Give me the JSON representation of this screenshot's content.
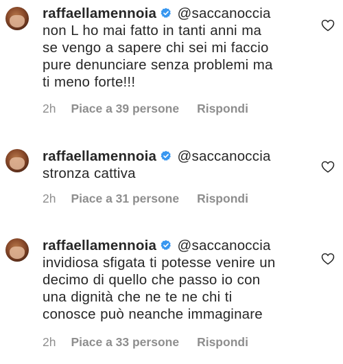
{
  "comments": [
    {
      "username": "raffaellamennoia",
      "mention": "@saccanoccia",
      "text": "non L ho mai fatto in tanti anni ma\nse vengo a sapere chi sei mi faccio\npure denunciare senza problemi ma\nti meno forte!!!",
      "time": "2h",
      "likes": "Piace a 39 persone",
      "reply": "Rispondi"
    },
    {
      "username": "raffaellamennoia",
      "mention": "@saccanoccia",
      "text": "stronza cattiva",
      "time": "2h",
      "likes": "Piace a 31 persone",
      "reply": "Rispondi"
    },
    {
      "username": "raffaellamennoia",
      "mention": "@saccanoccia",
      "text": "invidiosa sfigata ti potesse venire un\ndecimo di quello che passo io con\nuna dignità che ne te ne chi ti\nconosce può neanche immaginare",
      "time": "2h",
      "likes": "Piace a 33 persone",
      "reply": "Rispondi"
    }
  ],
  "icons": {
    "verified": "verified-badge-icon",
    "like": "heart-outline-icon"
  },
  "colors": {
    "verified_blue": "#3897f0",
    "meta_gray": "#8e8e8e",
    "text": "#262626"
  }
}
